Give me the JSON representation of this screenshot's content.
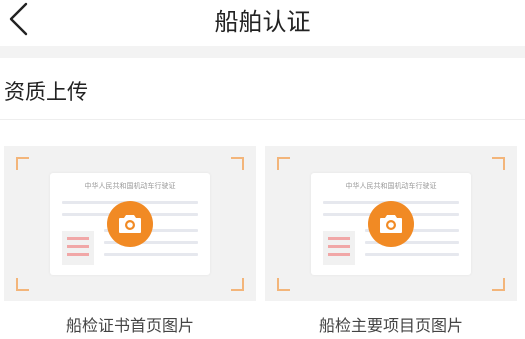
{
  "nav": {
    "title": "船舶认证",
    "back_icon": "chevron-left-icon"
  },
  "section": {
    "title": "资质上传"
  },
  "cards": [
    {
      "doc_heading": "中华人民共和国机动车行驶证",
      "caption": "船检证书首页图片",
      "icon": "camera-icon"
    },
    {
      "doc_heading": "中华人民共和国机动车行驶证",
      "caption": "船检主要项目页图片",
      "icon": "camera-icon"
    }
  ],
  "colors": {
    "accent": "#f18a24",
    "corner": "#f3b57a",
    "card_bg": "#f2f2f2",
    "divider_band": "#f3f3f3"
  }
}
